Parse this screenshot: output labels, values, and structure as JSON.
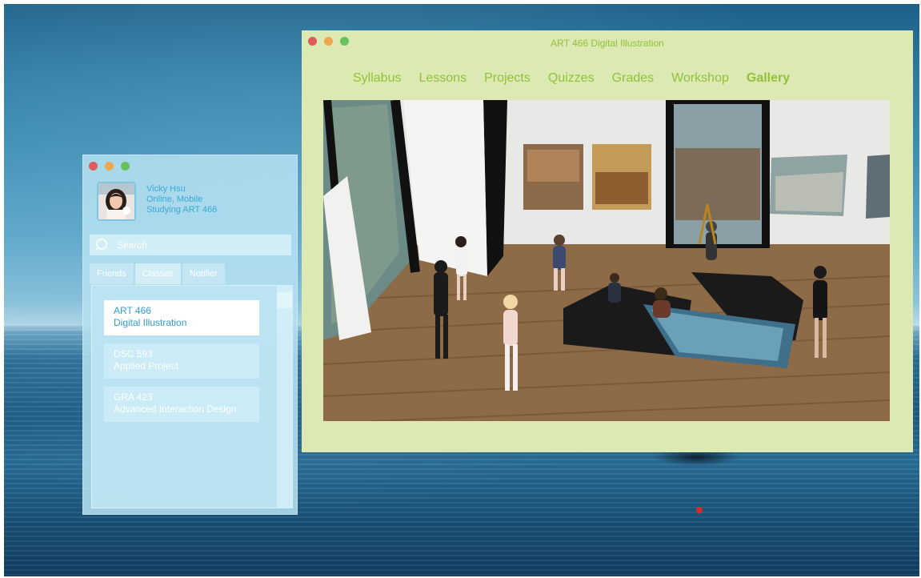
{
  "desktop": {},
  "social_panel": {
    "user": {
      "name": "Vicky Hsu",
      "status": "Online, Mobile",
      "activity": "Studying ART 466"
    },
    "search": {
      "placeholder": "Search"
    },
    "tabs": [
      {
        "label": "Friends",
        "active": false
      },
      {
        "label": "Classes",
        "active": true
      },
      {
        "label": "Notifier",
        "active": false
      }
    ],
    "classes": [
      {
        "code": "ART 466",
        "name": "Digital Illustration",
        "selected": true
      },
      {
        "code": "DSC 593",
        "name": "Applied Project",
        "selected": false
      },
      {
        "code": "GRA 423",
        "name": "Advanced Interaction Design",
        "selected": false
      }
    ]
  },
  "course_window": {
    "title": "ART 466 Digital Illustration",
    "nav": [
      {
        "label": "Syllabus",
        "active": false
      },
      {
        "label": "Lessons",
        "active": false
      },
      {
        "label": "Projects",
        "active": false
      },
      {
        "label": "Quizzes",
        "active": false
      },
      {
        "label": "Grades",
        "active": false
      },
      {
        "label": "Workshop",
        "active": false
      },
      {
        "label": "Gallery",
        "active": true
      }
    ]
  },
  "colors": {
    "nav_text": "#8fc23a",
    "window_bg": "#dde9b2",
    "panel_bg": "#b4e0f0",
    "panel_accent": "#3aa9d6"
  }
}
